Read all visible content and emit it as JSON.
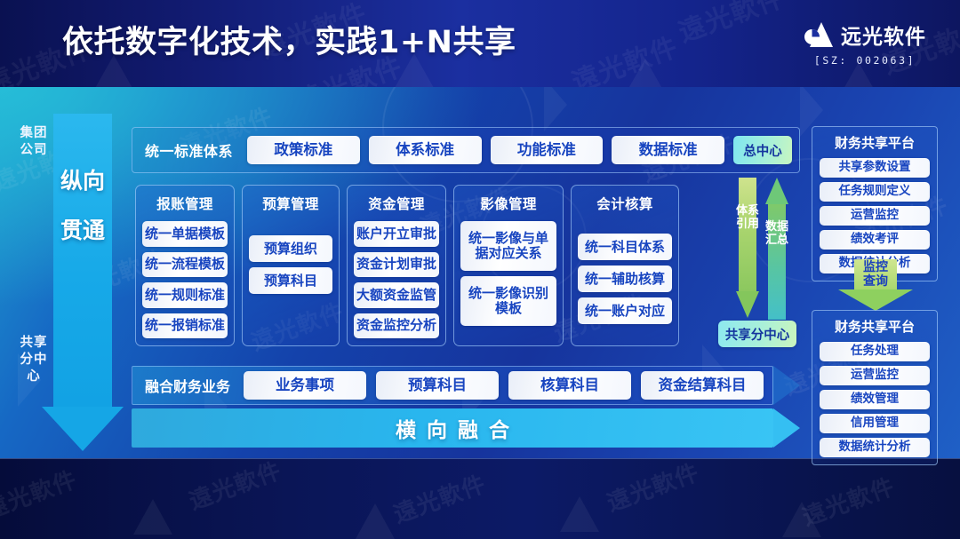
{
  "header": {
    "title": "依托数字化技术，实践1+N共享",
    "brand_name": "远光软件",
    "stock_code": "[SZ: 002063]",
    "logo_icon": "yuanguang-triangle-logo"
  },
  "left_axis": {
    "top_label": "集团公司",
    "bottom_label": "共享分中心",
    "arrow_text": "纵向贯通"
  },
  "standards_bar": {
    "label": "统一标准体系",
    "items": [
      "政策标准",
      "体系标准",
      "功能标准",
      "数据标准"
    ],
    "center_badge": "总中心"
  },
  "columns": [
    {
      "title": "报账管理",
      "items": [
        "统一单据模板",
        "统一流程模板",
        "统一规则标准",
        "统一报销标准"
      ]
    },
    {
      "title": "预算管理",
      "items": [
        "预算组织",
        "预算科目"
      ]
    },
    {
      "title": "资金管理",
      "items": [
        "账户开立审批",
        "资金计划审批",
        "大额资金监管",
        "资金监控分析"
      ]
    },
    {
      "title": "影像管理",
      "items": [
        "统一影像与单据对应关系",
        "统一影像识别模板"
      ]
    },
    {
      "title": "会计核算",
      "items": [
        "统一科目体系",
        "统一辅助核算",
        "统一账户对应"
      ]
    }
  ],
  "green_arrows": {
    "down_label": "体系引用",
    "up_label": "数据汇总",
    "sub_center": "共享分中心"
  },
  "right_panels": [
    {
      "title": "财务共享平台",
      "items": [
        "共享参数设置",
        "任务规则定义",
        "运营监控",
        "绩效考评",
        "数据统计分析"
      ]
    },
    {
      "title": "财务共享平台",
      "items": [
        "任务处理",
        "运营监控",
        "绩效管理",
        "信用管理",
        "数据统计分析"
      ]
    }
  ],
  "monitor_arrow": {
    "label_line1": "监控",
    "label_line2": "查询"
  },
  "fusion_row": {
    "label": "融合财务业务",
    "items": [
      "业务事项",
      "预算科目",
      "核算科目",
      "资金结算科目"
    ]
  },
  "horizontal_row": {
    "text": "横向融合"
  },
  "watermark": {
    "text": "遠光軟件"
  },
  "colors": {
    "header_blue": "#111a6e",
    "body_blue": "#1442ab",
    "cyan_arrow": "#17a9e8",
    "green_arrow": "#8cc85f",
    "teal_badge": "#8de9ef",
    "pill_text": "#1845c0",
    "footer_navy": "#0a1556"
  }
}
